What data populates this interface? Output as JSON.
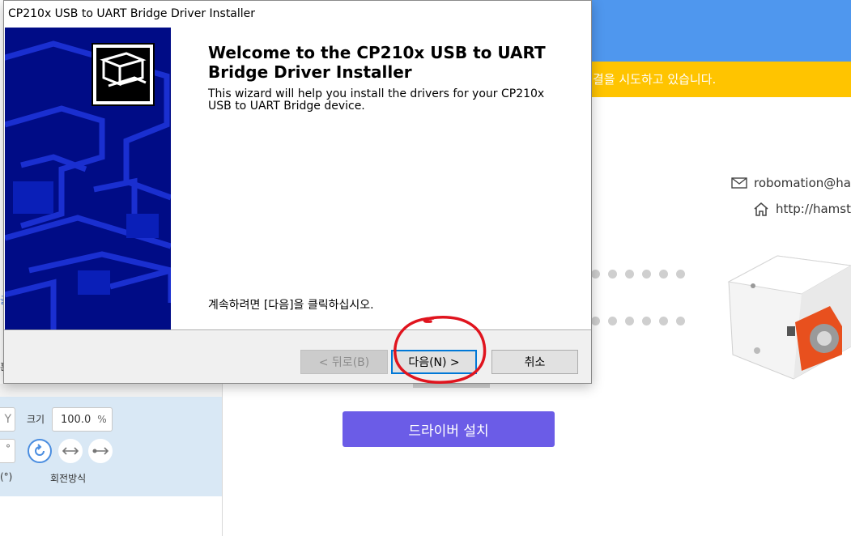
{
  "background": {
    "banner_text": "결을 시도하고 있습니다.",
    "email": "robomation@ham",
    "website": "http://hamste",
    "install_button": "드라이버 설치",
    "colors": {
      "banner_blue": "#4f97ee",
      "banner_yellow": "#ffc400",
      "install_purple": "#6b5ce7"
    }
  },
  "left_panel": {
    "y_field": "Y",
    "size_label": "크기",
    "size_value": "100.0",
    "size_unit": "%",
    "degree_field": "°",
    "degree_label": "(°)",
    "rotation_label": "회전방식",
    "edge_blue_char": "글",
    "edge_char": "흔"
  },
  "dialog": {
    "title": "CP210x USB to UART Bridge Driver Installer",
    "heading": "Welcome to the CP210x USB to UART Bridge Driver Installer",
    "description": "This wizard will help you install the drivers for your CP210x USB to UART Bridge device.",
    "continue_text": "계속하려면 [다음]을 클릭하십시오.",
    "buttons": {
      "back": "< 뒤로(B)",
      "next": "다음(N) >",
      "cancel": "취소"
    },
    "side_color": "#000c86"
  },
  "annotation": {
    "type": "red-hand-drawn-circle",
    "target": "next-button",
    "color": "#e0141e"
  }
}
